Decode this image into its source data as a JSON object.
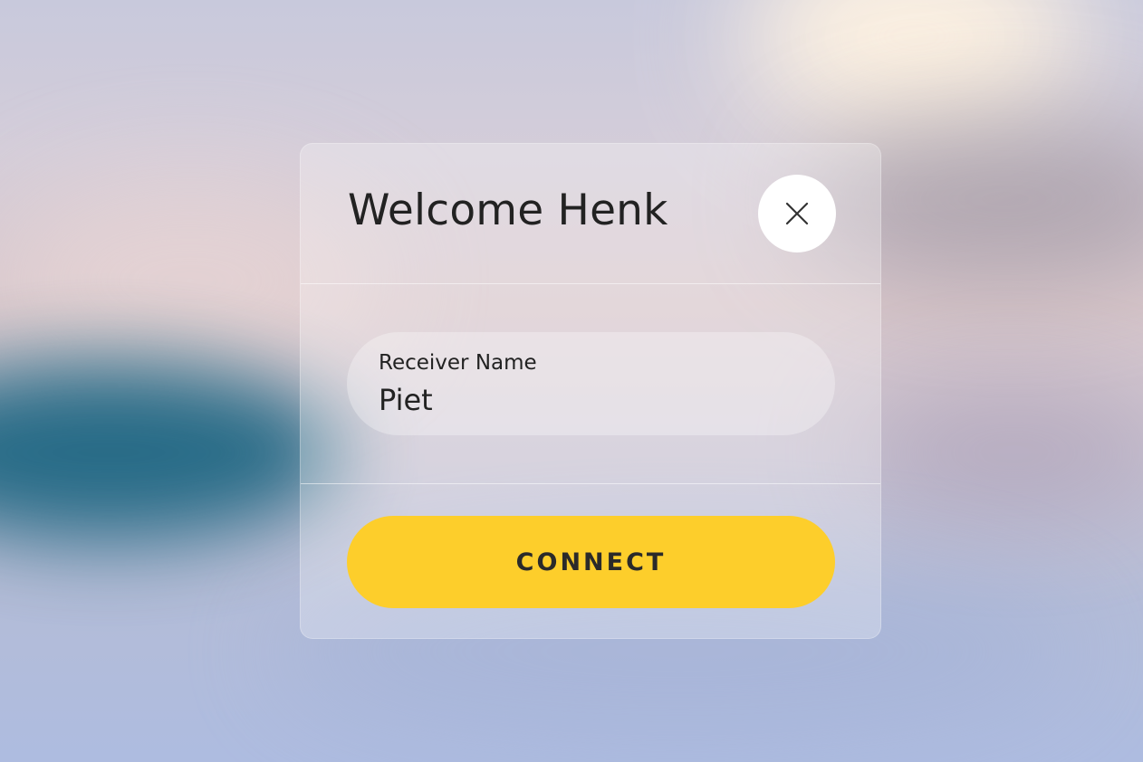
{
  "dialog": {
    "title": "Welcome Henk",
    "close_icon": "close-icon",
    "receiver_field": {
      "label": "Receiver Name",
      "value": "Piet"
    },
    "connect_label": "CONNECT"
  },
  "colors": {
    "connect_button": "#fdce2b",
    "text": "#222222",
    "close_button_bg": "#ffffff"
  }
}
